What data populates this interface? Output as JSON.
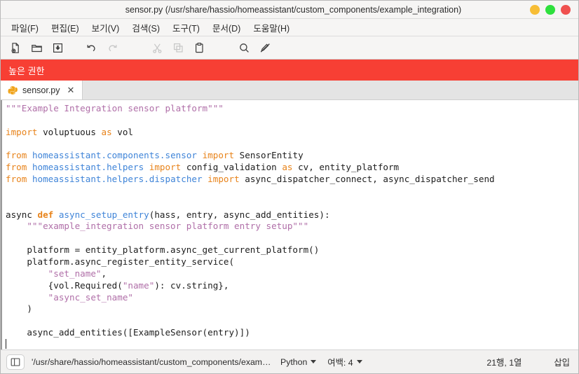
{
  "window": {
    "title": "sensor.py (/usr/share/hassio/homeassistant/custom_components/example_integration)",
    "controls": {
      "minimize": "minimize",
      "maximize": "maximize",
      "close": "close"
    },
    "colors": {
      "minimize": "#f7bd35",
      "maximize": "#2ee03d",
      "close": "#f0514f",
      "banner": "#f73f34",
      "keyword": "#e8831a",
      "module": "#3f84d8",
      "string": "#b06fa8"
    }
  },
  "menubar": {
    "items": [
      {
        "label": "파일(F)",
        "name": "file"
      },
      {
        "label": "편집(E)",
        "name": "edit"
      },
      {
        "label": "보기(V)",
        "name": "view"
      },
      {
        "label": "검색(S)",
        "name": "search"
      },
      {
        "label": "도구(T)",
        "name": "tools"
      },
      {
        "label": "문서(D)",
        "name": "documents"
      },
      {
        "label": "도움말(H)",
        "name": "help"
      }
    ]
  },
  "toolbar": {
    "buttons": [
      {
        "name": "new-document-icon",
        "enabled": true
      },
      {
        "name": "open-folder-icon",
        "enabled": true
      },
      {
        "name": "save-icon",
        "enabled": true
      },
      {
        "name": "undo-icon",
        "enabled": true
      },
      {
        "name": "redo-icon",
        "enabled": false
      },
      {
        "name": "cut-icon",
        "enabled": false
      },
      {
        "name": "copy-icon",
        "enabled": false
      },
      {
        "name": "paste-icon",
        "enabled": true
      },
      {
        "name": "search-icon",
        "enabled": true
      },
      {
        "name": "replace-icon",
        "enabled": true
      }
    ]
  },
  "banner": {
    "text": "높은 권한"
  },
  "tabs": [
    {
      "label": "sensor.py",
      "icon": "python-logo-icon",
      "close": "✕",
      "active": true
    }
  ],
  "editor": {
    "lines": [
      [
        {
          "t": "\"\"\"Example Integration sensor platform\"\"\"",
          "c": "doc"
        }
      ],
      [],
      [
        {
          "t": "import",
          "c": "k"
        },
        {
          "t": " voluptuous ",
          "c": "pl"
        },
        {
          "t": "as",
          "c": "k"
        },
        {
          "t": " vol",
          "c": "pl"
        }
      ],
      [],
      [
        {
          "t": "from",
          "c": "k"
        },
        {
          "t": " ",
          "c": "pl"
        },
        {
          "t": "homeassistant.components.sensor",
          "c": "mod"
        },
        {
          "t": " ",
          "c": "pl"
        },
        {
          "t": "import",
          "c": "k"
        },
        {
          "t": " SensorEntity",
          "c": "pl"
        }
      ],
      [
        {
          "t": "from",
          "c": "k"
        },
        {
          "t": " ",
          "c": "pl"
        },
        {
          "t": "homeassistant.helpers",
          "c": "mod"
        },
        {
          "t": " ",
          "c": "pl"
        },
        {
          "t": "import",
          "c": "k"
        },
        {
          "t": " config_validation ",
          "c": "pl"
        },
        {
          "t": "as",
          "c": "k"
        },
        {
          "t": " cv, entity_platform",
          "c": "pl"
        }
      ],
      [
        {
          "t": "from",
          "c": "k"
        },
        {
          "t": " ",
          "c": "pl"
        },
        {
          "t": "homeassistant.helpers.dispatcher",
          "c": "mod"
        },
        {
          "t": " ",
          "c": "pl"
        },
        {
          "t": "import",
          "c": "k"
        },
        {
          "t": " async_dispatcher_connect, async_dispatcher_send",
          "c": "pl"
        }
      ],
      [],
      [],
      [
        {
          "t": "async ",
          "c": "pl"
        },
        {
          "t": "def",
          "c": "kb"
        },
        {
          "t": " ",
          "c": "pl"
        },
        {
          "t": "async_setup_entry",
          "c": "mod"
        },
        {
          "t": "(hass, entry, async_add_entities):",
          "c": "pl"
        }
      ],
      [
        {
          "t": "    \"\"\"example_integration sensor platform entry setup\"\"\"",
          "c": "doc"
        }
      ],
      [],
      [
        {
          "t": "    platform = entity_platform.async_get_current_platform()",
          "c": "pl"
        }
      ],
      [
        {
          "t": "    platform.async_register_entity_service(",
          "c": "pl"
        }
      ],
      [
        {
          "t": "        ",
          "c": "pl"
        },
        {
          "t": "\"set_name\"",
          "c": "str"
        },
        {
          "t": ",",
          "c": "pl"
        }
      ],
      [
        {
          "t": "        {vol.Required(",
          "c": "pl"
        },
        {
          "t": "\"name\"",
          "c": "str"
        },
        {
          "t": "): cv.string},",
          "c": "pl"
        }
      ],
      [
        {
          "t": "        ",
          "c": "pl"
        },
        {
          "t": "\"async_set_name\"",
          "c": "str"
        }
      ],
      [
        {
          "t": "    )",
          "c": "pl"
        }
      ],
      [],
      [
        {
          "t": "    async_add_entities([ExampleSensor(entry)])",
          "c": "pl"
        }
      ],
      [
        {
          "t": "",
          "c": "pl",
          "caret": true
        }
      ]
    ]
  },
  "statusbar": {
    "sidebar_toggle": "sidebar-toggle-icon",
    "path": "'/usr/share/hassio/homeassistant/custom_components/example_integ⋯",
    "language": "Python",
    "indent": "여백: 4",
    "position": "21행, 1열",
    "mode": "삽입"
  }
}
